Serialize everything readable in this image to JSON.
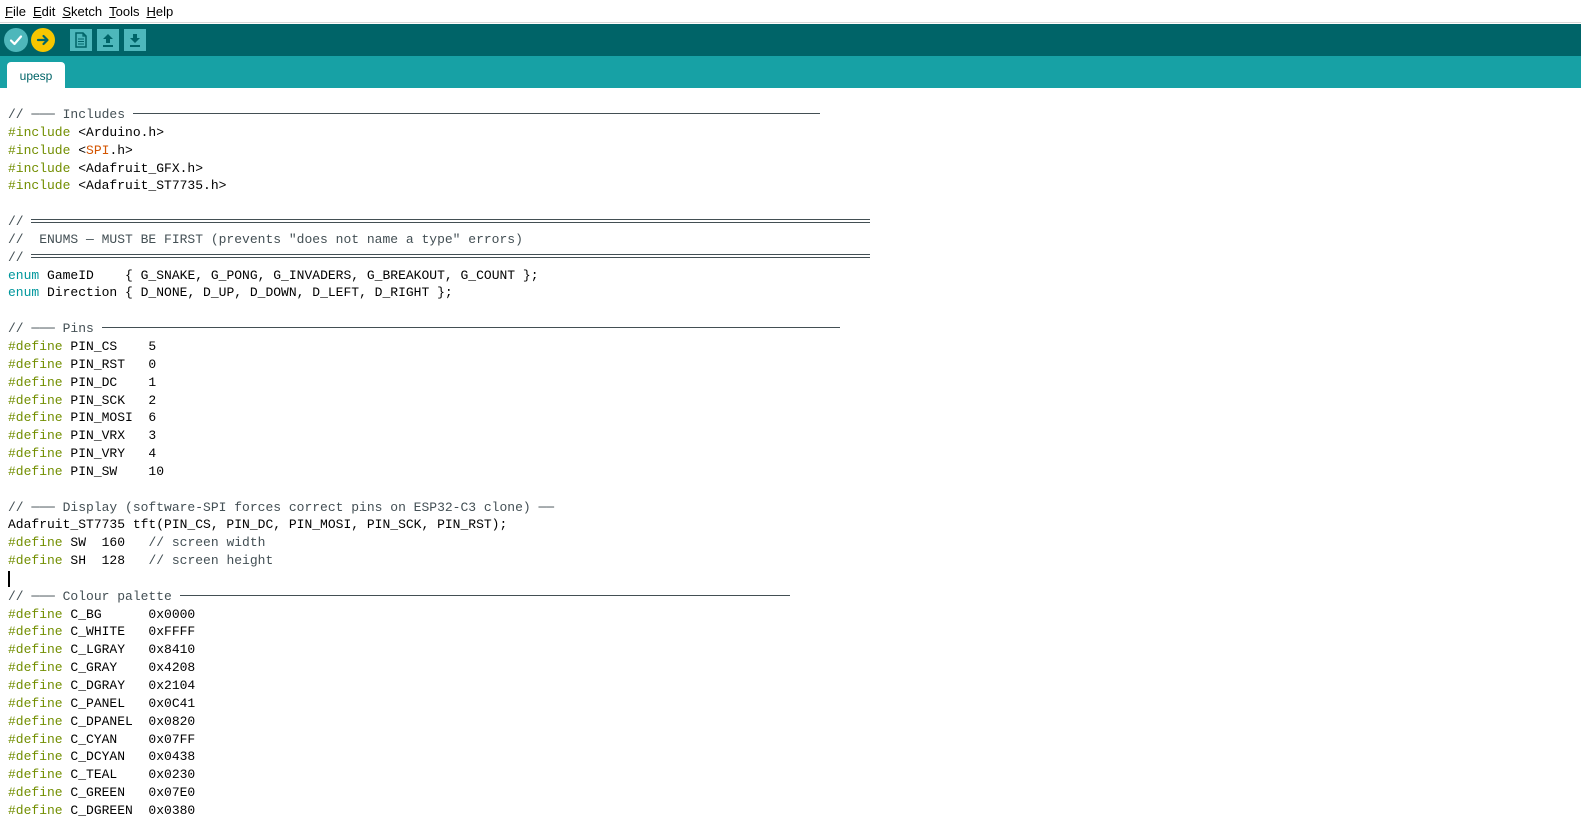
{
  "menubar": {
    "items": [
      {
        "key": "F",
        "rest": "ile"
      },
      {
        "key": "E",
        "rest": "dit"
      },
      {
        "key": "S",
        "rest": "ketch"
      },
      {
        "key": "T",
        "rest": "ools"
      },
      {
        "key": "H",
        "rest": "elp"
      }
    ]
  },
  "toolbar": {
    "buttons": [
      "verify-icon",
      "upload-icon",
      "new-sketch-icon",
      "open-sketch-icon",
      "save-sketch-icon"
    ]
  },
  "tabs": [
    {
      "label": "upesp"
    }
  ],
  "colors": {
    "toolbar": "#006468",
    "tabbar": "#17a1a5",
    "comment": "#434f54",
    "preprocessor": "#728e00",
    "keyword_type": "#00979c",
    "library": "#d35400"
  },
  "code_lines": [
    [
      [
        "comment",
        "// ─── Includes "
      ],
      [
        "hr1",
        "820"
      ]
    ],
    [
      [
        "kw",
        "#include "
      ],
      [
        "plain",
        "<Arduino.h>"
      ]
    ],
    [
      [
        "kw",
        "#include "
      ],
      [
        "plain",
        "<"
      ],
      [
        "lib",
        "SPI"
      ],
      [
        "plain",
        ".h>"
      ]
    ],
    [
      [
        "kw",
        "#include "
      ],
      [
        "plain",
        "<Adafruit_GFX.h>"
      ]
    ],
    [
      [
        "kw",
        "#include "
      ],
      [
        "plain",
        "<Adafruit_ST7735.h>"
      ]
    ],
    [],
    [
      [
        "comment",
        "// "
      ],
      [
        "hr2",
        "870"
      ]
    ],
    [
      [
        "comment",
        "//  ENUMS — MUST BE FIRST (prevents \"does not name a type\" errors)"
      ]
    ],
    [
      [
        "comment",
        "// "
      ],
      [
        "hr2",
        "870"
      ]
    ],
    [
      [
        "type",
        "enum"
      ],
      [
        "plain",
        " GameID    { G_SNAKE, G_PONG, G_INVADERS, G_BREAKOUT, G_COUNT };"
      ]
    ],
    [
      [
        "type",
        "enum"
      ],
      [
        "plain",
        " Direction { D_NONE, D_UP, D_DOWN, D_LEFT, D_RIGHT };"
      ]
    ],
    [],
    [
      [
        "comment",
        "// ─── Pins "
      ],
      [
        "hr1",
        "840"
      ]
    ],
    [
      [
        "kw",
        "#define"
      ],
      [
        "plain",
        " PIN_CS    5"
      ]
    ],
    [
      [
        "kw",
        "#define"
      ],
      [
        "plain",
        " PIN_RST   0"
      ]
    ],
    [
      [
        "kw",
        "#define"
      ],
      [
        "plain",
        " PIN_DC    1"
      ]
    ],
    [
      [
        "kw",
        "#define"
      ],
      [
        "plain",
        " PIN_SCK   2"
      ]
    ],
    [
      [
        "kw",
        "#define"
      ],
      [
        "plain",
        " PIN_MOSI  6"
      ]
    ],
    [
      [
        "kw",
        "#define"
      ],
      [
        "plain",
        " PIN_VRX   3"
      ]
    ],
    [
      [
        "kw",
        "#define"
      ],
      [
        "plain",
        " PIN_VRY   4"
      ]
    ],
    [
      [
        "kw",
        "#define"
      ],
      [
        "plain",
        " PIN_SW    10"
      ]
    ],
    [],
    [
      [
        "comment",
        "// ─── Display (software-SPI forces correct pins on ESP32-C3 clone) ──"
      ]
    ],
    [
      [
        "plain",
        "Adafruit_ST7735 tft(PIN_CS, PIN_DC, PIN_MOSI, PIN_SCK, PIN_RST);"
      ]
    ],
    [
      [
        "kw",
        "#define"
      ],
      [
        "plain",
        " SW  160   "
      ],
      [
        "comment",
        "// screen width"
      ]
    ],
    [
      [
        "kw",
        "#define"
      ],
      [
        "plain",
        " SH  128   "
      ],
      [
        "comment",
        "// screen height"
      ]
    ],
    [],
    [
      [
        "comment",
        "// ─── Colour palette "
      ],
      [
        "hr1",
        "790"
      ]
    ],
    [
      [
        "kw",
        "#define"
      ],
      [
        "plain",
        " C_BG      0x0000"
      ]
    ],
    [
      [
        "kw",
        "#define"
      ],
      [
        "plain",
        " C_WHITE   0xFFFF"
      ]
    ],
    [
      [
        "kw",
        "#define"
      ],
      [
        "plain",
        " C_LGRAY   0x8410"
      ]
    ],
    [
      [
        "kw",
        "#define"
      ],
      [
        "plain",
        " C_GRAY    0x4208"
      ]
    ],
    [
      [
        "kw",
        "#define"
      ],
      [
        "plain",
        " C_DGRAY   0x2104"
      ]
    ],
    [
      [
        "kw",
        "#define"
      ],
      [
        "plain",
        " C_PANEL   0x0C41"
      ]
    ],
    [
      [
        "kw",
        "#define"
      ],
      [
        "plain",
        " C_DPANEL  0x0820"
      ]
    ],
    [
      [
        "kw",
        "#define"
      ],
      [
        "plain",
        " C_CYAN    0x07FF"
      ]
    ],
    [
      [
        "kw",
        "#define"
      ],
      [
        "plain",
        " C_DCYAN   0x0438"
      ]
    ],
    [
      [
        "kw",
        "#define"
      ],
      [
        "plain",
        " C_TEAL    0x0230"
      ]
    ],
    [
      [
        "kw",
        "#define"
      ],
      [
        "plain",
        " C_GREEN   0x07E0"
      ]
    ],
    [
      [
        "kw",
        "#define"
      ],
      [
        "plain",
        " C_DGREEN  0x0380"
      ]
    ]
  ],
  "caret_line": 26
}
